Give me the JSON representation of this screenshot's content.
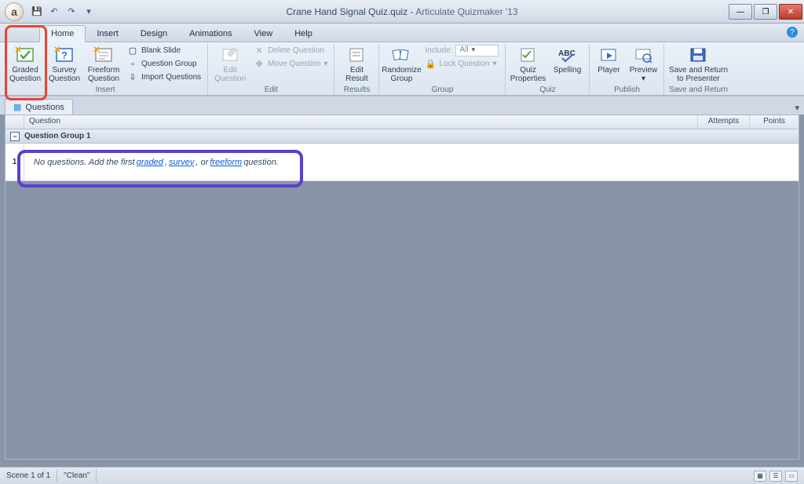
{
  "title": {
    "file": "Crane Hand Signal Quiz.quiz",
    "sep": " - ",
    "app": "Articulate Quizmaker '13"
  },
  "tabs": [
    "Home",
    "Insert",
    "Design",
    "Animations",
    "View",
    "Help"
  ],
  "active_tab": 0,
  "ribbon": {
    "insert_group": {
      "graded": "Graded Question",
      "survey": "Survey Question",
      "freeform": "Freeform Question",
      "blank": "Blank Slide",
      "qgroup": "Question Group",
      "import": "Import Questions",
      "label": "Insert"
    },
    "edit_group": {
      "edit": "Edit Question",
      "delete": "Delete Question",
      "move": "Move Question",
      "label": "Edit"
    },
    "results_group": {
      "editresult": "Edit Result",
      "label": "Results"
    },
    "group_group": {
      "randomize": "Randomize Group",
      "include_label": "Include:",
      "include_value": "All",
      "lock": "Lock Question",
      "label": "Group"
    },
    "quiz_group": {
      "props": "Quiz Properties",
      "spelling": "Spelling",
      "label": "Quiz"
    },
    "publish_group": {
      "player": "Player",
      "preview": "Preview",
      "label": "Publish"
    },
    "save_group": {
      "save": "Save and Return to Presenter",
      "label": "Save and Return"
    }
  },
  "panel_tab": "Questions",
  "grid": {
    "headers": {
      "question": "Question",
      "attempts": "Attempts",
      "points": "Points"
    },
    "group_name": "Question Group 1",
    "row1": {
      "index": "1",
      "text_before": "No questions. Add the first ",
      "link_graded": "graded",
      "text_mid1": ", ",
      "link_survey": "survey",
      "text_mid2": ", or ",
      "link_freeform": "freeform",
      "text_after": " question."
    }
  },
  "status": {
    "scene": "Scene 1 of 1",
    "clean": "\"Clean\""
  }
}
